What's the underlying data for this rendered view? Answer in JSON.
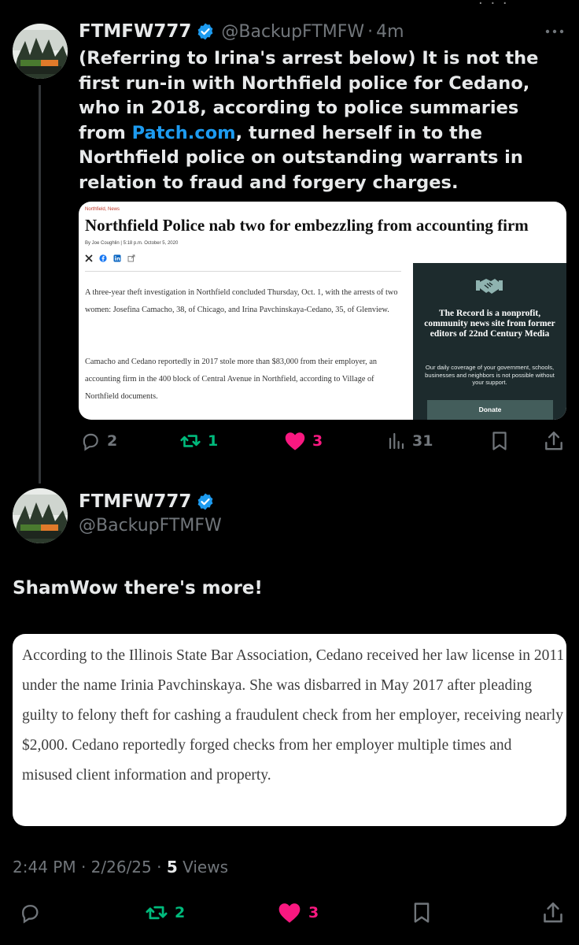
{
  "top_glyph": "· · ·",
  "tweet1": {
    "display_name": "FTMFW777",
    "handle": "@BackupFTMFW",
    "separator": "·",
    "time": "4m",
    "text_before_link": "(Referring  to Irina's arrest below) It is not the first run-in with Northfield police for Cedano, who in 2018, according to police summaries from ",
    "link_text": "Patch.com",
    "text_after_link": ", turned herself in to the Northfield police on outstanding warrants in relation to fraud and forgery charges.",
    "media": {
      "category": "Northfield, News",
      "headline": "Northfield Police nab two for embezzling from accounting firm",
      "byline": "By Joe Coughlin | 5:18 p.m. October 5, 2020",
      "social_icons": [
        "x-icon",
        "facebook-icon",
        "linkedin-icon",
        "share-icon"
      ],
      "paragraph1": "A three-year theft investigation in Northfield concluded Thursday, Oct. 1, with the arrests of two women: Josefina Camacho, 38, of Chicago, and Irina Pavchinskaya-Cedano, 35, of Glenview.",
      "paragraph2": "Camacho and Cedano reportedly in 2017 stole more than $83,000 from their employer, an accounting firm in the 400 block of Central Avenue in Northfield, according to Village of Northfield documents.",
      "promo_title": "The Record is a nonprofit, community news site from former editors of 22nd Century Media",
      "promo_body": "Our daily coverage of your government, schools, businesses and neighbors is not possible without your support.",
      "donate_label": "Donate"
    },
    "actions": {
      "replies": "2",
      "reposts": "1",
      "likes": "3",
      "views": "31"
    }
  },
  "tweet2": {
    "display_name": "FTMFW777",
    "handle": "@BackupFTMFW",
    "text": "ShamWow there's more!",
    "quote_text": "According to the Illinois State Bar Association, Cedano received her law license in 2011 under the name Irinia Pavchinskaya. She was disbarred in May 2017 after pleading guilty to felony theft for cashing a fraudulent check from her employer, receiving nearly $2,000. Cedano reportedly forged checks from her employer multiple times and misused client information and property.",
    "timestamp": "2:44 PM · 2/26/25 · ",
    "views_count": "5",
    "views_label": " Views",
    "actions": {
      "reposts": "2",
      "likes": "3"
    }
  },
  "colors": {
    "background": "#000000",
    "text_primary": "#e7e9ea",
    "text_secondary": "#71767b",
    "link": "#1d9bf0",
    "verified": "#1d9bf0",
    "repost_active": "#00ba7c",
    "like_active": "#f91880",
    "promo_panel": "#1d2b2d",
    "donate_button": "#435d5b"
  }
}
